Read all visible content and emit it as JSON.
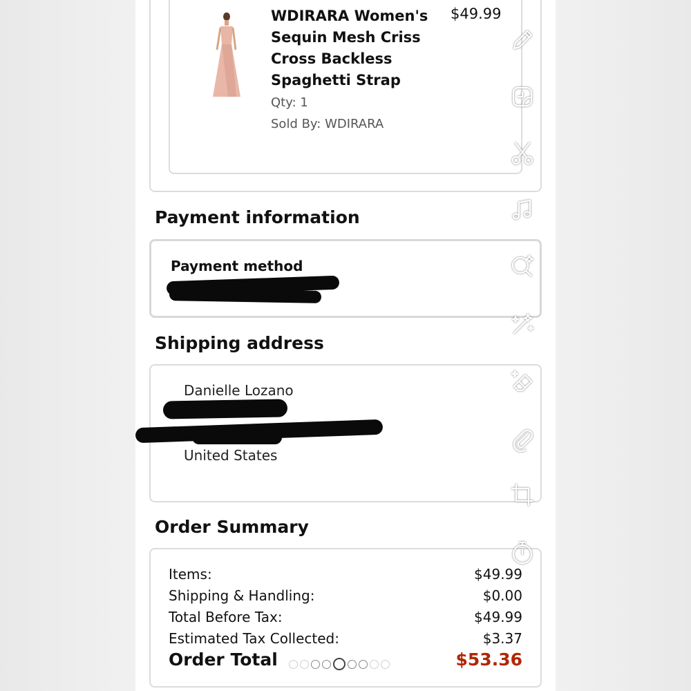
{
  "product": {
    "title": "WDIRARA Women's Sequin Mesh Criss Cross Backless Spaghetti Strap",
    "price": "$49.99",
    "qty": "Qty: 1",
    "sold_by": "Sold By: WDIRARA"
  },
  "payment": {
    "heading": "Payment information",
    "method_label": "Payment method"
  },
  "shipping": {
    "heading": "Shipping address",
    "name": "Danielle Lozano",
    "country": "United States"
  },
  "summary": {
    "heading": "Order Summary",
    "rows": [
      {
        "label": "Items:",
        "value": "$49.99"
      },
      {
        "label": "Shipping & Handling:",
        "value": "$0.00"
      },
      {
        "label": "Total Before Tax:",
        "value": "$49.99"
      },
      {
        "label": "Estimated Tax Collected:",
        "value": "$3.37"
      }
    ],
    "total_label": "Order Total",
    "total_value": "$53.36"
  },
  "colors": {
    "total_red": "#b12704",
    "border": "#dcdcdc"
  },
  "tools": [
    "pencil-icon",
    "sticker-icon",
    "scissors-icon",
    "music-icon",
    "search-sparkle-icon",
    "magic-wand-icon",
    "eraser-icon",
    "paperclip-icon",
    "crop-icon",
    "timer-icon"
  ]
}
